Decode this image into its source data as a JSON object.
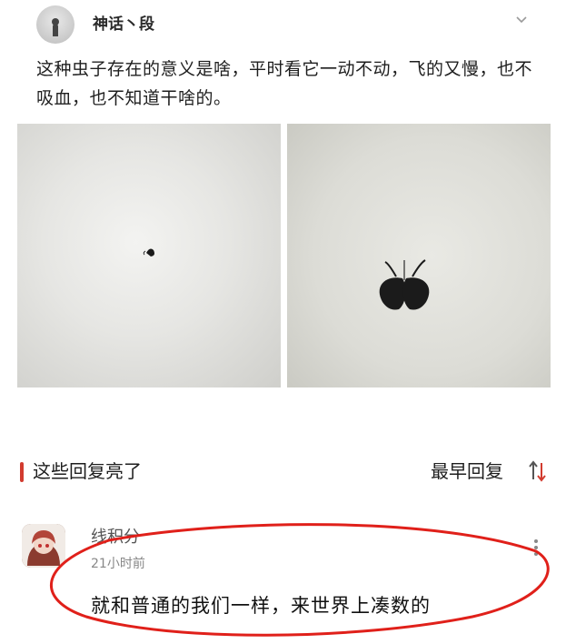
{
  "post": {
    "username": "神话丶段",
    "text": "这种虫子存在的意义是啥，平时看它一动不动，飞的又慢，也不吸血，也不知道干啥的。",
    "icons": {
      "menu": "chevron-down-icon"
    }
  },
  "replies_section": {
    "title": "这些回复亮了",
    "sort_label": "最早回复",
    "accent_color": "#d23b2f",
    "icons": {
      "sort": "sort-arrows-icon"
    }
  },
  "comment": {
    "username": "线积分",
    "time": "21小时前",
    "text": "就和普通的我们一样，来世界上凑数的",
    "icons": {
      "more": "more-vertical-icon"
    }
  },
  "annotation": {
    "color": "#e0201a"
  }
}
